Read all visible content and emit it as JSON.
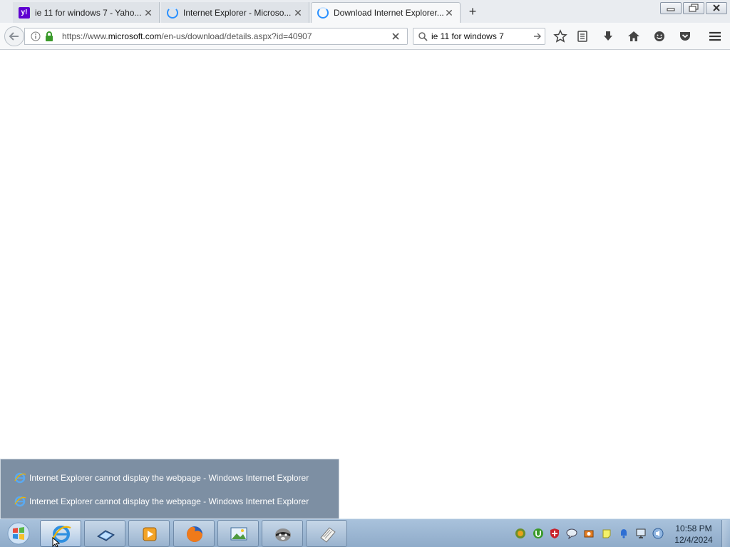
{
  "browser": {
    "tabs": [
      {
        "label": "ie 11 for windows 7 - Yaho...",
        "favicon": "yahoo-icon",
        "active": false
      },
      {
        "label": "Internet Explorer - Microso...",
        "favicon": "loading-spinner-icon",
        "active": false
      },
      {
        "label": "Download Internet Explorer...",
        "favicon": "loading-spinner-icon",
        "active": true
      }
    ],
    "url": {
      "scheme": "https://www.",
      "host": "microsoft.com",
      "path": "/en-us/download/details.aspx?id=40907"
    },
    "search_value": "ie 11 for windows 7",
    "toolbar_icons": [
      "star-icon",
      "reading-list-icon",
      "download-icon",
      "home-icon",
      "smiley-icon",
      "pocket-icon",
      "menu-icon"
    ]
  },
  "taskbar_preview": {
    "items": [
      {
        "label": "Internet Explorer cannot display the webpage - Windows Internet Explorer"
      },
      {
        "label": "Internet Explorer cannot display the webpage - Windows Internet Explorer"
      }
    ]
  },
  "taskbar": {
    "pinned": [
      "internet-explorer-icon",
      "display-settings-icon",
      "media-player-icon",
      "firefox-icon",
      "picture-viewer-icon",
      "raccoon-app-icon",
      "notepad-icon"
    ],
    "clock": {
      "time": "10:58 PM",
      "date": "12/4/2024"
    }
  },
  "colors": {
    "yahoo": "#5f01d1",
    "accent": "#2a90ff",
    "taskbar": "#9fb9d4"
  }
}
